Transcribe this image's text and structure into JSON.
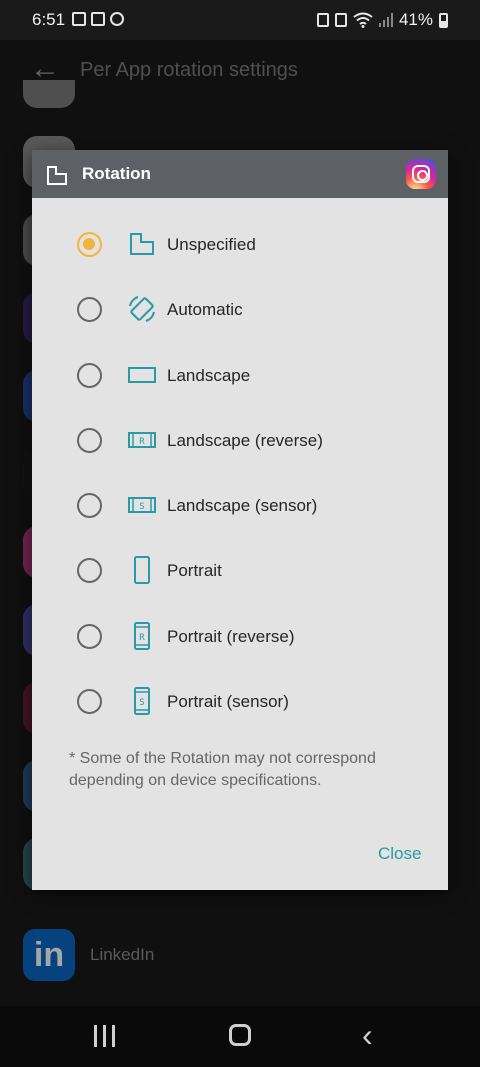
{
  "status_bar": {
    "time": "6:51",
    "battery": "41%"
  },
  "app_bar": {
    "title": "Per App rotation settings"
  },
  "background_list": {
    "visible_app_label": "LinkedIn",
    "visible_app_icon_text": "in"
  },
  "dialog": {
    "title": "Rotation",
    "app_icon": "instagram-icon",
    "selected": "Unspecified",
    "options": [
      {
        "label": "Unspecified",
        "icon": "unspecified-rotation-icon",
        "checked": true
      },
      {
        "label": "Automatic",
        "icon": "auto-rotate-icon",
        "checked": false
      },
      {
        "label": "Landscape",
        "icon": "landscape-icon",
        "checked": false
      },
      {
        "label": "Landscape (reverse)",
        "icon": "landscape-reverse-icon",
        "icon_letter": "R",
        "checked": false
      },
      {
        "label": "Landscape (sensor)",
        "icon": "landscape-sensor-icon",
        "icon_letter": "S",
        "checked": false
      },
      {
        "label": "Portrait",
        "icon": "portrait-icon",
        "checked": false
      },
      {
        "label": "Portrait (reverse)",
        "icon": "portrait-reverse-icon",
        "icon_letter": "R",
        "checked": false
      },
      {
        "label": "Portrait (sensor)",
        "icon": "portrait-sensor-icon",
        "icon_letter": "S",
        "checked": false
      }
    ],
    "note": "* Some of the Rotation may not correspond depending on device specifications.",
    "close_label": "Close"
  },
  "colors": {
    "accent_teal": "#2a9aa6",
    "radio_selected": "#f2b53a",
    "dialog_header": "#5d6166",
    "dialog_body": "#e3e3e3"
  }
}
